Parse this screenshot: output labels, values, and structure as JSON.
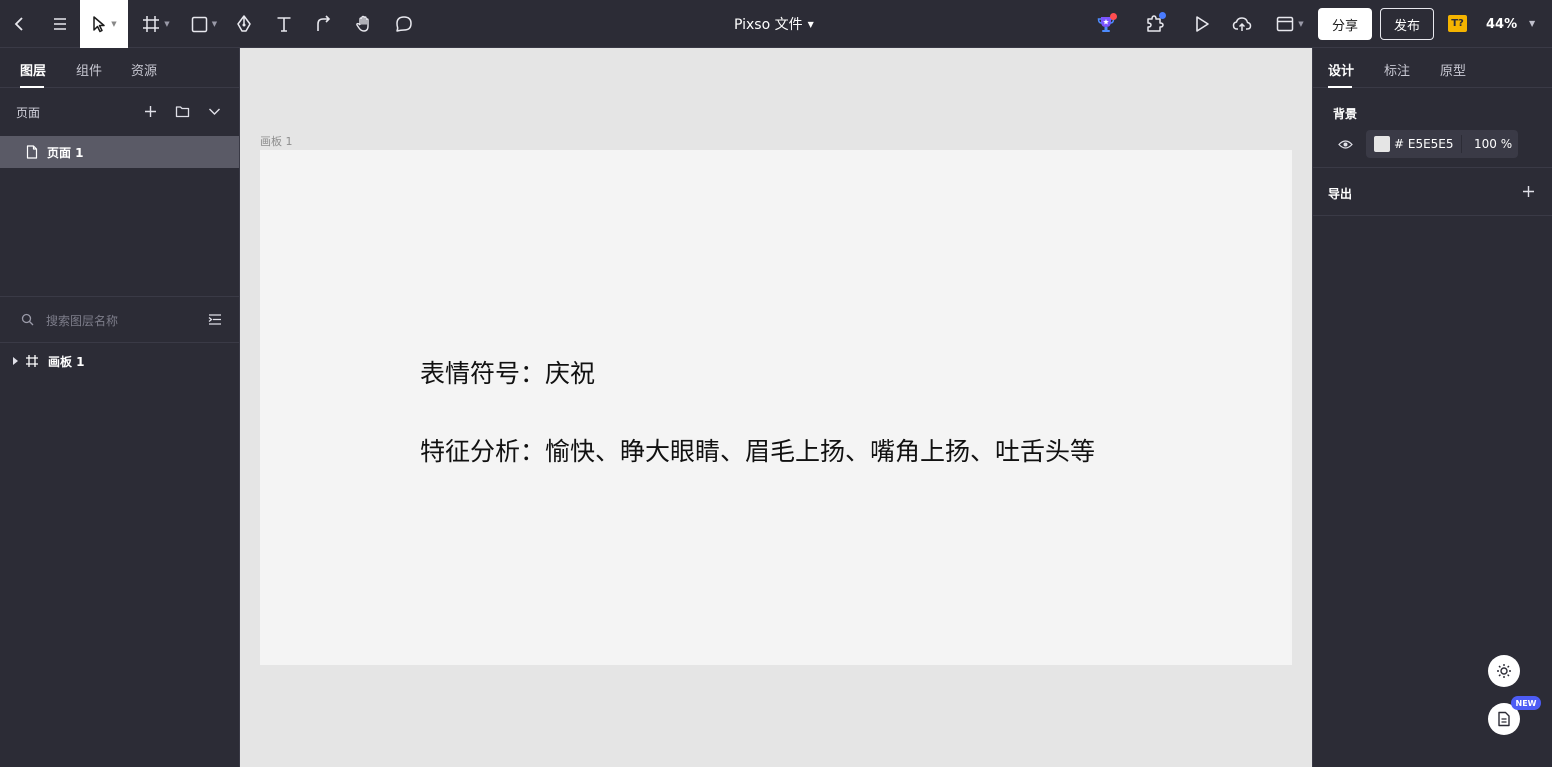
{
  "toolbar": {
    "doc_title": "Pixso 文件",
    "share_label": "分享",
    "publish_label": "发布",
    "plugin_badge": "T?",
    "zoom": "44%"
  },
  "left_panel": {
    "tabs": [
      {
        "label": "图层"
      },
      {
        "label": "组件"
      },
      {
        "label": "资源"
      }
    ],
    "pages_title": "页面",
    "pages": [
      {
        "label": "页面 1"
      }
    ],
    "search_placeholder": "搜索图层名称",
    "layers": [
      {
        "label": "画板 1"
      }
    ]
  },
  "canvas": {
    "frame_label": "画板 1",
    "line1": "表情符号：庆祝",
    "line2": "特征分析：愉快、睁大眼睛、眉毛上扬、嘴角上扬、吐舌头等"
  },
  "right_panel": {
    "tabs": [
      {
        "label": "设计"
      },
      {
        "label": "标注"
      },
      {
        "label": "原型"
      }
    ],
    "background_title": "背景",
    "bg_hex": "# E5E5E5",
    "bg_opacity": "100 %",
    "export_title": "导出"
  },
  "floating": {
    "new_badge": "NEW"
  },
  "colors": {
    "panel_bg": "#2c2c36",
    "canvas_bg": "#e5e5e5",
    "frame_bg": "#f4f4f4",
    "accent_badge": "#4d5cf5",
    "plugin_badge": "#f5b400"
  }
}
